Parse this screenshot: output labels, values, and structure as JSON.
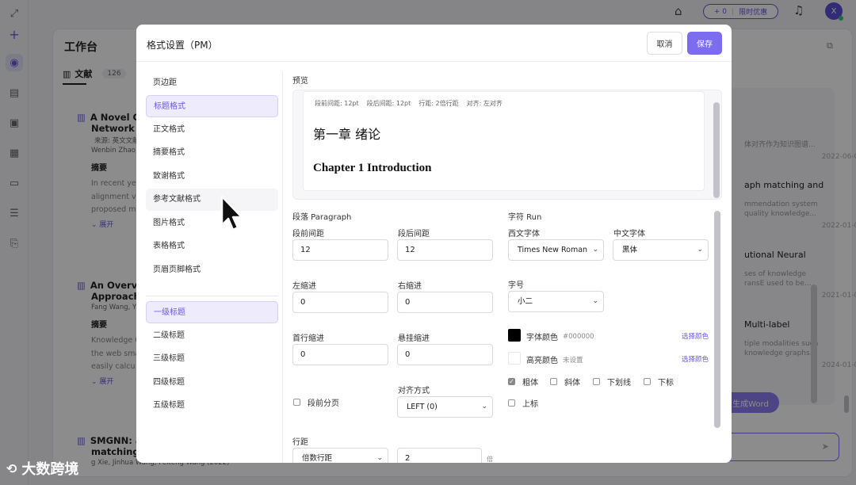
{
  "topbar": {
    "credit_text": "+ 0",
    "promo_text": "限时优惠",
    "avatar_letter": "X"
  },
  "workspace": {
    "title": "工作台",
    "tab_label": "文献",
    "tab_count": "126",
    "papers": [
      {
        "title": "A Novel Co",
        "title2": "Network fo",
        "source": "来源: 英文文献",
        "authors": "Wenbin Zhao,",
        "abstract_label": "摘要",
        "abstract_lines": [
          "In recent yea",
          "alignment vi",
          "proposed m"
        ],
        "expand": "展开"
      },
      {
        "title": "An Overvie",
        "title2": "Approache",
        "source": "",
        "authors": "Fang Wang, Y",
        "abstract_label": "摘要",
        "abstract_lines": [
          "Knowledge C",
          "the web sma",
          "easily calcu"
        ],
        "expand": "展开"
      },
      {
        "title": "SMGNN: a",
        "title2": "matching a",
        "source": "",
        "authors": "g Xie, Jinhua Wang, Peiteng Wang (2022)",
        "abstract_label": "",
        "abstract_lines": [],
        "expand": ""
      }
    ],
    "right_cards": [
      {
        "title": "",
        "line1": "体对齐作为知识图谱...",
        "line2": "",
        "date": "2022-06-01"
      },
      {
        "title": "aph matching and",
        "line1": "mmendation system",
        "line2": "quality knowledge...",
        "date": "2022-01-01"
      },
      {
        "title": "utional Neural",
        "line1": "ses of knowledge",
        "line2": "ransE used to be...",
        "date": "2021-01-01"
      },
      {
        "title": "Multi-label",
        "line1": "tiple modalities such",
        "line2": "knowledge graphs...",
        "date": "2024-01-01"
      }
    ],
    "generate_word": "生成Word"
  },
  "modal": {
    "title": "格式设置（PM）",
    "cancel_label": "取消",
    "save_label": "保存",
    "nav_top": [
      "页边距",
      "标题格式",
      "正文格式",
      "摘要格式",
      "致谢格式",
      "参考文献格式",
      "图片格式",
      "表格格式",
      "页眉页脚格式"
    ],
    "nav_levels": [
      "一级标题",
      "二级标题",
      "三级标题",
      "四级标题",
      "五级标题"
    ],
    "preview": {
      "label": "预览",
      "info": [
        "段前间距: 12pt",
        "段后间距: 12pt",
        "行距: 2倍行距",
        "对齐: 左对齐"
      ],
      "heading_cn": "第一章 绪论",
      "heading_en": "Chapter 1 Introduction"
    },
    "paragraph": {
      "section_label": "段落 Paragraph",
      "space_before_label": "段前间距",
      "space_before": "12",
      "space_after_label": "段后间距",
      "space_after": "12",
      "left_indent_label": "左缩进",
      "left_indent": "0",
      "right_indent_label": "右缩进",
      "right_indent": "0",
      "first_indent_label": "首行缩进",
      "first_indent": "0",
      "hanging_indent_label": "悬挂缩进",
      "hanging_indent": "0",
      "page_break_label": "段前分页",
      "align_label": "对齐方式",
      "align_value": "LEFT (0)",
      "line_spacing_label": "行距",
      "line_spacing_type": "倍数行距",
      "line_spacing_value": "2",
      "line_spacing_unit": "倍"
    },
    "run": {
      "section_label": "字符 Run",
      "western_font_label": "西文字体",
      "western_font": "Times New Roman",
      "cn_font_label": "中文字体",
      "cn_font": "黑体",
      "size_label": "字号",
      "size_value": "小二",
      "font_color_label": "字体颜色",
      "font_color_value": "#000000",
      "font_color_pick": "选择颜色",
      "highlight_label": "高亮颜色",
      "highlight_value": "未设置",
      "highlight_pick": "选择颜色",
      "bold": "粗体",
      "italic": "斜体",
      "underline": "下划线",
      "subscript": "下标",
      "superscript": "上标"
    }
  },
  "colors": {
    "accent": "#7b6cf0",
    "font_color": "#000000"
  },
  "watermark": "大数跨境"
}
